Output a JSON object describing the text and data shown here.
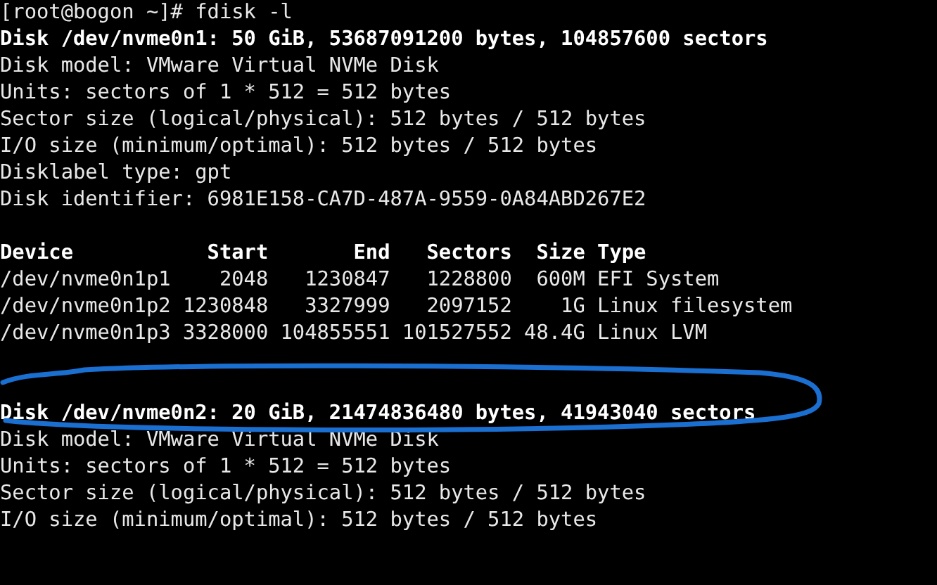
{
  "terminal": {
    "lines": [
      {
        "kind": "normal",
        "text": "[root@bogon ~]# fdisk -l"
      },
      {
        "kind": "bold",
        "text": "Disk /dev/nvme0n1: 50 GiB, 53687091200 bytes, 104857600 sectors"
      },
      {
        "kind": "normal",
        "text": "Disk model: VMware Virtual NVMe Disk"
      },
      {
        "kind": "normal",
        "text": "Units: sectors of 1 * 512 = 512 bytes"
      },
      {
        "kind": "normal",
        "text": "Sector size (logical/physical): 512 bytes / 512 bytes"
      },
      {
        "kind": "normal",
        "text": "I/O size (minimum/optimal): 512 bytes / 512 bytes"
      },
      {
        "kind": "normal",
        "text": "Disklabel type: gpt"
      },
      {
        "kind": "normal",
        "text": "Disk identifier: 6981E158-CA7D-487A-9559-0A84ABD267E2"
      },
      {
        "kind": "blank"
      },
      {
        "kind": "bold",
        "text": "Device           Start       End   Sectors  Size Type"
      },
      {
        "kind": "normal",
        "text": "/dev/nvme0n1p1    2048   1230847   1228800  600M EFI System"
      },
      {
        "kind": "normal",
        "text": "/dev/nvme0n1p2 1230848   3327999   2097152    1G Linux filesystem"
      },
      {
        "kind": "normal",
        "text": "/dev/nvme0n1p3 3328000 104855551 101527552 48.4G Linux LVM"
      },
      {
        "kind": "blank"
      },
      {
        "kind": "blank"
      },
      {
        "kind": "bold",
        "text": "Disk /dev/nvme0n2: 20 GiB, 21474836480 bytes, 41943040 sectors"
      },
      {
        "kind": "normal",
        "text": "Disk model: VMware Virtual NVMe Disk"
      },
      {
        "kind": "normal",
        "text": "Units: sectors of 1 * 512 = 512 bytes"
      },
      {
        "kind": "normal",
        "text": "Sector size (logical/physical): 512 bytes / 512 bytes"
      },
      {
        "kind": "normal",
        "text": "I/O size (minimum/optimal): 512 bytes / 512 bytes"
      }
    ]
  }
}
